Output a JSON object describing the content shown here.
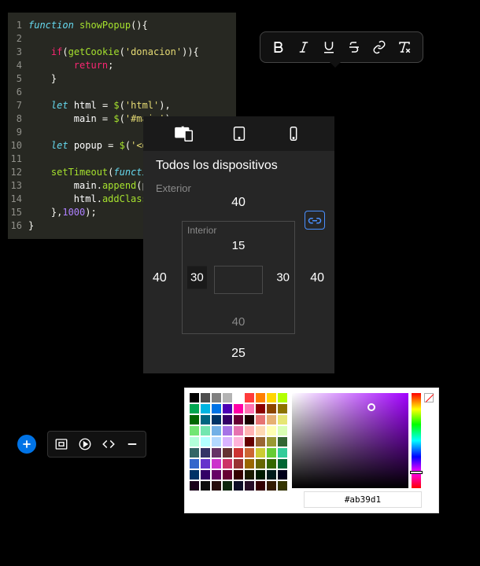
{
  "code": {
    "lines": [
      {
        "n": 1,
        "tokens": [
          [
            "kw",
            "function"
          ],
          [
            "punc",
            " "
          ],
          [
            "fn",
            "showPopup"
          ],
          [
            "punc",
            "(){"
          ]
        ]
      },
      {
        "n": 2,
        "tokens": []
      },
      {
        "n": 3,
        "tokens": [
          [
            "punc",
            "    "
          ],
          [
            "ctrl",
            "if"
          ],
          [
            "punc",
            "("
          ],
          [
            "fn",
            "getCookie"
          ],
          [
            "punc",
            "("
          ],
          [
            "str",
            "'donacion'"
          ],
          [
            "punc",
            ")){"
          ]
        ]
      },
      {
        "n": 4,
        "tokens": [
          [
            "punc",
            "        "
          ],
          [
            "ctrl",
            "return"
          ],
          [
            "punc",
            ";"
          ]
        ]
      },
      {
        "n": 5,
        "tokens": [
          [
            "punc",
            "    }"
          ]
        ]
      },
      {
        "n": 6,
        "tokens": []
      },
      {
        "n": 7,
        "tokens": [
          [
            "punc",
            "    "
          ],
          [
            "kw",
            "let"
          ],
          [
            "punc",
            " "
          ],
          [
            "var",
            "html"
          ],
          [
            "punc",
            " = "
          ],
          [
            "fn",
            "$"
          ],
          [
            "punc",
            "("
          ],
          [
            "str",
            "'html'"
          ],
          [
            "punc",
            "),"
          ]
        ]
      },
      {
        "n": 8,
        "tokens": [
          [
            "punc",
            "        "
          ],
          [
            "var",
            "main"
          ],
          [
            "punc",
            " = "
          ],
          [
            "fn",
            "$"
          ],
          [
            "punc",
            "("
          ],
          [
            "str",
            "'#main'"
          ],
          [
            "punc",
            ");"
          ]
        ]
      },
      {
        "n": 9,
        "tokens": []
      },
      {
        "n": 10,
        "tokens": [
          [
            "punc",
            "    "
          ],
          [
            "kw",
            "let"
          ],
          [
            "punc",
            " "
          ],
          [
            "var",
            "popup"
          ],
          [
            "punc",
            " = "
          ],
          [
            "fn",
            "$"
          ],
          [
            "punc",
            "("
          ],
          [
            "str",
            "'<di"
          ]
        ]
      },
      {
        "n": 11,
        "tokens": []
      },
      {
        "n": 12,
        "tokens": [
          [
            "punc",
            "    "
          ],
          [
            "fn",
            "setTimeout"
          ],
          [
            "punc",
            "("
          ],
          [
            "kw",
            "functio"
          ]
        ]
      },
      {
        "n": 13,
        "tokens": [
          [
            "punc",
            "        "
          ],
          [
            "var",
            "main"
          ],
          [
            "punc",
            "."
          ],
          [
            "fn",
            "append"
          ],
          [
            "punc",
            "("
          ],
          [
            "var",
            "po"
          ]
        ]
      },
      {
        "n": 14,
        "tokens": [
          [
            "punc",
            "        "
          ],
          [
            "var",
            "html"
          ],
          [
            "punc",
            "."
          ],
          [
            "fn",
            "addClass"
          ],
          [
            "punc",
            "("
          ]
        ]
      },
      {
        "n": 15,
        "tokens": [
          [
            "punc",
            "    },"
          ],
          [
            "num",
            "1000"
          ],
          [
            "punc",
            ");"
          ]
        ]
      },
      {
        "n": 16,
        "tokens": [
          [
            "punc",
            "}"
          ]
        ]
      }
    ]
  },
  "textToolbar": {
    "bold": "B",
    "italic": "I",
    "underline": "U",
    "strike": "S",
    "link": "link",
    "clear": "T"
  },
  "spacing": {
    "title": "Todos los dispositivos",
    "exteriorLabel": "Exterior",
    "interiorLabel": "Interior",
    "margin": {
      "top": "40",
      "right": "40",
      "bottom": "25",
      "left": "40"
    },
    "padding": {
      "top": "15",
      "right": "30",
      "bottom": "40",
      "left": "30"
    }
  },
  "colorPicker": {
    "hex": "#ab39d1",
    "swatches": [
      [
        "#000000",
        "#4d4d4d",
        "#808080",
        "#b3b3b3",
        "#ffffff",
        "#ff3b3b",
        "#ff8000",
        "#ffd500",
        "#b2ff00"
      ],
      [
        "#00a651",
        "#00b5e2",
        "#0073e6",
        "#4d00b5",
        "#ff00a6",
        "#ff73b3",
        "#8c0000",
        "#8c4600",
        "#8c7300"
      ],
      [
        "#006600",
        "#006680",
        "#003366",
        "#330066",
        "#660033",
        "#1a0000",
        "#e67373",
        "#e6b073",
        "#e6e673"
      ],
      [
        "#73e673",
        "#73e6b0",
        "#73b0e6",
        "#a673e6",
        "#e673b0",
        "#ffb3b3",
        "#ffd9b3",
        "#ffffb3",
        "#d9ffb3"
      ],
      [
        "#b3ffd9",
        "#b3ffff",
        "#b3d9ff",
        "#d9b3ff",
        "#ffb3d9",
        "#660000",
        "#996633",
        "#999933",
        "#336633"
      ],
      [
        "#336666",
        "#333366",
        "#663366",
        "#663333",
        "#cc3333",
        "#cc6633",
        "#cccc33",
        "#66cc33",
        "#33cc99"
      ],
      [
        "#3366cc",
        "#6633cc",
        "#cc33cc",
        "#cc3366",
        "#993333",
        "#996600",
        "#666600",
        "#336600",
        "#006633"
      ],
      [
        "#003366",
        "#330066",
        "#660066",
        "#660033",
        "#330000",
        "#1a1a00",
        "#001a00",
        "#001a1a",
        "#00001a"
      ],
      [
        "#1a001a",
        "#0d0d0d",
        "#260d0d",
        "#0d260d",
        "#0d0d26",
        "#260d26",
        "#330000",
        "#331a00",
        "#333300"
      ]
    ]
  }
}
